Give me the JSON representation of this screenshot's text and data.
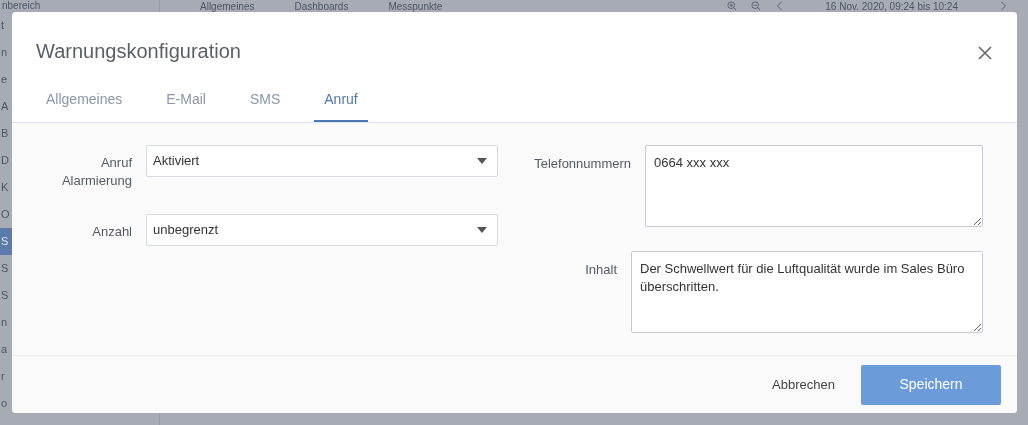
{
  "background": {
    "sidebar_header": "nbereich",
    "sidebar_items": [
      {
        "label": "t",
        "selected": false
      },
      {
        "label": "n",
        "selected": false
      },
      {
        "label": "e",
        "selected": false
      },
      {
        "label": "A",
        "selected": false
      },
      {
        "label": "B",
        "selected": false
      },
      {
        "label": "D",
        "selected": false
      },
      {
        "label": "K",
        "selected": false
      },
      {
        "label": "O",
        "selected": false
      },
      {
        "label": "S",
        "selected": true
      },
      {
        "label": "S",
        "selected": false
      },
      {
        "label": "S",
        "selected": false
      },
      {
        "label": "n",
        "selected": false
      },
      {
        "label": "a",
        "selected": false
      },
      {
        "label": "r",
        "selected": false
      },
      {
        "label": "o",
        "selected": false
      }
    ],
    "tabs": [
      {
        "label": "Allgemeines"
      },
      {
        "label": "Dashboards"
      },
      {
        "label": "Messpunkte"
      }
    ],
    "time_range": "16 Nov. 2020, 09:24 bis 10:24"
  },
  "dialog": {
    "title": "Warnungskonfiguration",
    "tabs": [
      {
        "label": "Allgemeines",
        "selected": false
      },
      {
        "label": "E-Mail",
        "selected": false
      },
      {
        "label": "SMS",
        "selected": false
      },
      {
        "label": "Anruf",
        "selected": true
      }
    ],
    "left_fields": [
      {
        "label": "Anruf Alarmierung",
        "value": "Aktiviert"
      },
      {
        "label": "Anzahl",
        "value": "unbegrenzt"
      }
    ],
    "right_fields": [
      {
        "label": "Telefonnummern",
        "value": "0664 xxx xxx"
      },
      {
        "label": "Inhalt",
        "value": "Der Schwellwert für die Luftqualität wurde im Sales Büro überschritten."
      }
    ],
    "buttons": [
      {
        "label": "Abbrechen",
        "kind": "link"
      },
      {
        "label": "Speichern",
        "kind": "primary"
      }
    ]
  }
}
